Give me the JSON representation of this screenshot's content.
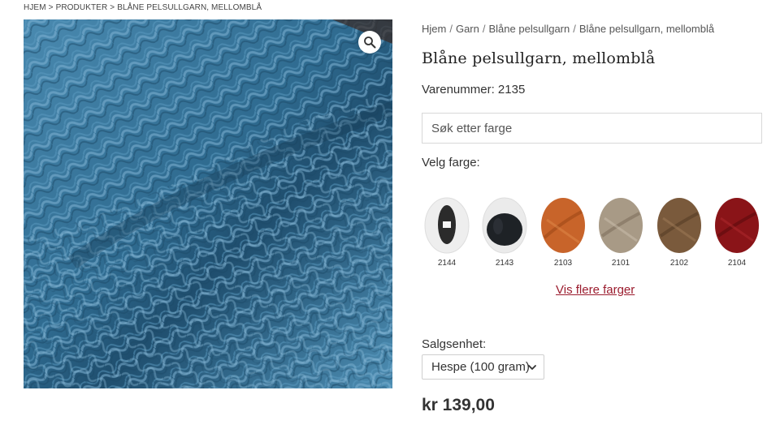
{
  "top_breadcrumb": {
    "items": [
      "HJEM",
      "PRODUKTER",
      "BLÅNE PELSULLGARN, MELLOMBLÅ"
    ],
    "separator": ">"
  },
  "breadcrumb": {
    "items": [
      "Hjem",
      "Garn",
      "Blåne pelsullgarn",
      "Blåne pelsullgarn, mellomblå"
    ],
    "separator": "/"
  },
  "product": {
    "title": "Blåne pelsullgarn, mellomblå",
    "sku_label": "Varenummer: 2135",
    "price": "kr 139,00"
  },
  "icons": {
    "zoom": "magnifier-icon",
    "select_arrow": "chevron-down-icon"
  },
  "search": {
    "placeholder": "Søk etter farge",
    "value": ""
  },
  "colors": {
    "label": "Velg farge:",
    "swatches": [
      {
        "code": "2144",
        "color": "#2b2b2b",
        "bg": "#f0f0f0"
      },
      {
        "code": "2143",
        "color": "#1e2226",
        "bg": "#ececec"
      },
      {
        "code": "2103",
        "color": "#c8642a",
        "bg": "#c8642a"
      },
      {
        "code": "2101",
        "color": "#a89a86",
        "bg": "#a89a86"
      },
      {
        "code": "2102",
        "color": "#7a5a3c",
        "bg": "#7a5a3c"
      },
      {
        "code": "2104",
        "color": "#8a1418",
        "bg": "#8a1418"
      }
    ],
    "more_link": "Vis flere farger"
  },
  "sales_unit": {
    "label": "Salgsenhet:",
    "selected": "Hespe (100 gram)"
  },
  "theme": {
    "link_color": "#9b1c2e",
    "yarn_blue": "#3a7aa0"
  }
}
